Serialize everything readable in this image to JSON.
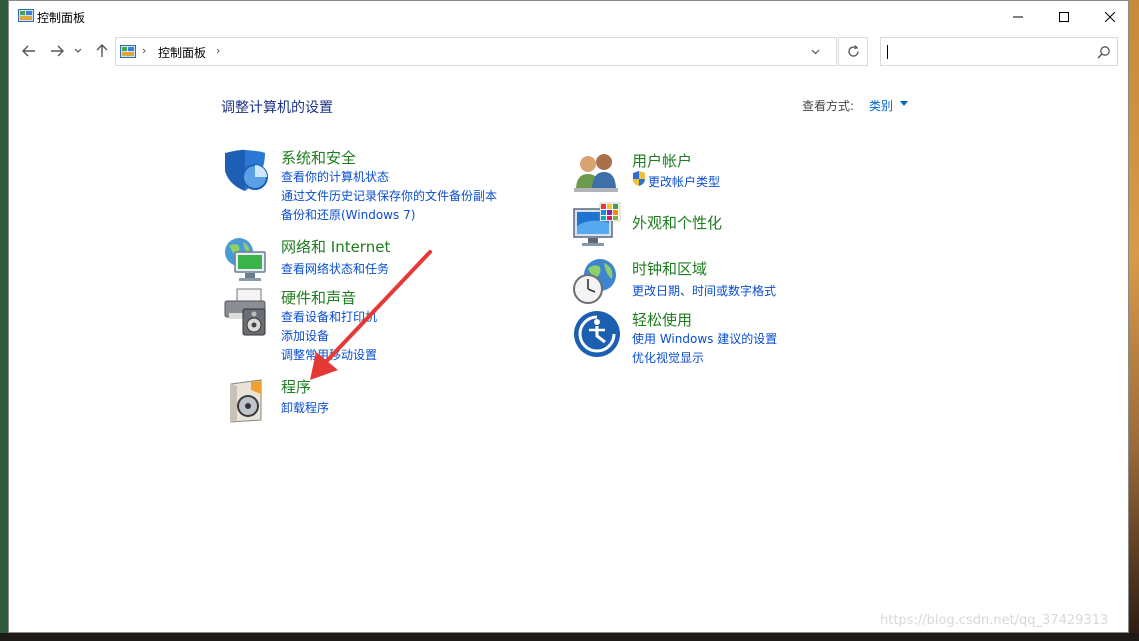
{
  "window": {
    "title": "控制面板"
  },
  "address_bar": {
    "path_label": "控制面板",
    "search_placeholder": ""
  },
  "page": {
    "heading": "调整计算机的设置",
    "view_by_label": "查看方式:",
    "view_by_value": "类别"
  },
  "categories_left": [
    {
      "title": "系统和安全",
      "icon": "shield-icon",
      "links": [
        "查看你的计算机状态",
        "通过文件历史记录保存你的文件备份副本",
        "备份和还原(Windows 7)"
      ]
    },
    {
      "title": "网络和 Internet",
      "icon": "network-globe-icon",
      "links": [
        "查看网络状态和任务"
      ]
    },
    {
      "title": "硬件和声音",
      "icon": "printer-speaker-icon",
      "links": [
        "查看设备和打印机",
        "添加设备",
        "调整常用移动设置"
      ]
    },
    {
      "title": "程序",
      "icon": "programs-disc-icon",
      "links": [
        "卸载程序"
      ]
    }
  ],
  "categories_right": [
    {
      "title": "用户帐户",
      "icon": "users-icon",
      "links": [
        "更改帐户类型"
      ]
    },
    {
      "title": "外观和个性化",
      "icon": "monitor-palette-icon",
      "links": []
    },
    {
      "title": "时钟和区域",
      "icon": "clock-globe-icon",
      "links": [
        "更改日期、时间或数字格式"
      ]
    },
    {
      "title": "轻松使用",
      "icon": "ease-of-access-icon",
      "links": [
        "使用 Windows 建议的设置",
        "优化视觉显示"
      ]
    }
  ],
  "watermark": "https://blog.csdn.net/qq_37429313",
  "colors": {
    "heading": "#1e3287",
    "category_title": "#1e7d1e",
    "link": "#0a4ecf",
    "annotation_arrow": "#e53935"
  }
}
